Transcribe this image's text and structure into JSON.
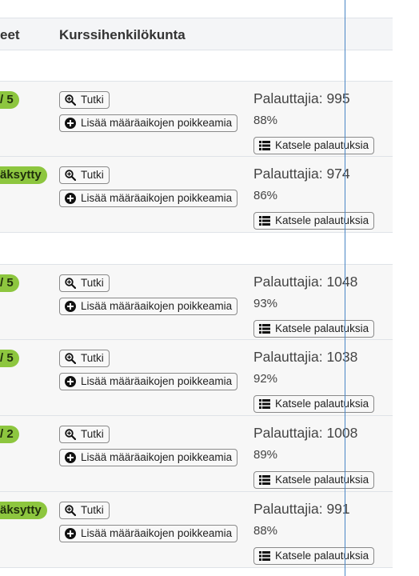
{
  "header": {
    "col_prev": "eet",
    "col_staff": "Kurssihenkilökunta"
  },
  "labels": {
    "tutki": "Tutki",
    "add_deviations": "Lisää määräaikojen poikkeamia",
    "view_submissions": "Katsele palautuksia"
  },
  "icons": {
    "tutki": "zoom-in-icon",
    "add_deviations": "plus-circle-icon",
    "view_submissions": "list-icon"
  },
  "colors": {
    "badge": "#8dc63f",
    "divider": "#4a86c5"
  },
  "rows": [
    {
      "badge": "/ 5",
      "count": "Palauttajia: 995",
      "percent": "88%"
    },
    {
      "badge": "äksytty",
      "count": "Palauttajia: 974",
      "percent": "86%"
    },
    {
      "badge": "/ 5",
      "count": "Palauttajia: 1048",
      "percent": "93%"
    },
    {
      "badge": "/ 5",
      "count": "Palauttajia: 1038",
      "percent": "92%"
    },
    {
      "badge": "/ 2",
      "count": "Palauttajia: 1008",
      "percent": "89%"
    },
    {
      "badge": "äksytty",
      "count": "Palauttajia: 991",
      "percent": "88%"
    }
  ]
}
